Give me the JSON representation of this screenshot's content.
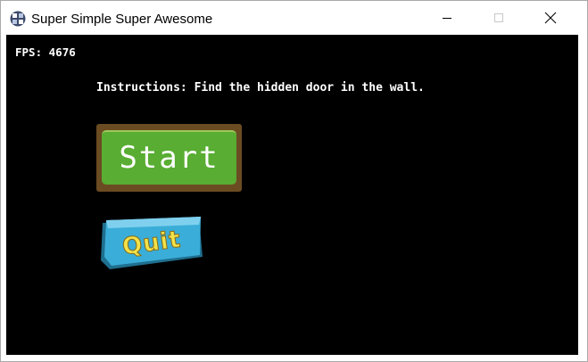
{
  "window": {
    "title": "Super Simple Super Awesome",
    "min_icon": "minimize-icon",
    "max_icon": "maximize-icon",
    "close_icon": "close-icon"
  },
  "hud": {
    "fps_label": "FPS:",
    "fps_value": "4676"
  },
  "instructions": "Instructions: Find the hidden door in the wall.",
  "menu": {
    "start_label": "Start",
    "quit_label": "Quit"
  },
  "colors": {
    "background": "#000000",
    "start_fill": "#58ad32",
    "start_frame": "#6b4b22",
    "quit_panel": "#3aaed8",
    "quit_text": "#f2e24a"
  }
}
